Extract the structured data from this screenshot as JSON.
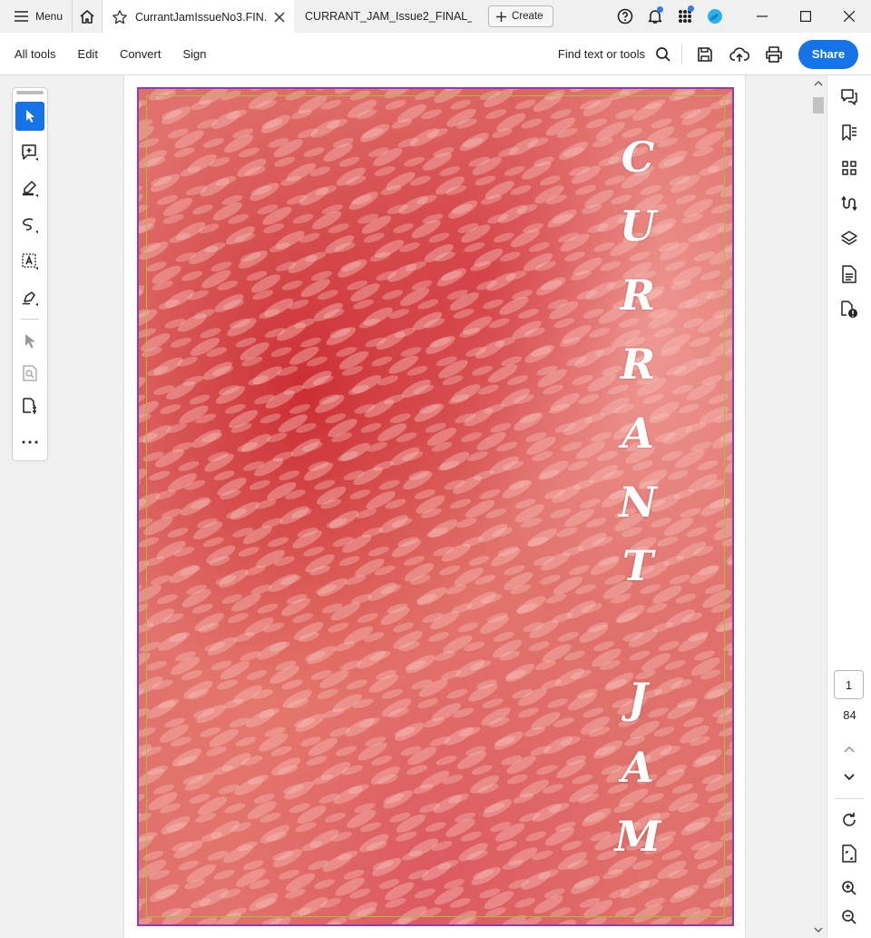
{
  "titlebar": {
    "menu_label": "Menu",
    "tabs": [
      {
        "label": "CurrantJamIssueNo3.FIN...",
        "active": true
      },
      {
        "label": "CURRANT_JAM_Issue2_FINAL_...",
        "active": false
      }
    ],
    "create_label": "Create"
  },
  "toolbar": {
    "menus": [
      "All tools",
      "Edit",
      "Convert",
      "Sign"
    ],
    "find_label": "Find text or tools",
    "share_label": "Share"
  },
  "document": {
    "cover_title_letters": [
      "C",
      "U",
      "R",
      "R",
      "A",
      "N",
      "T",
      "J",
      "A",
      "M"
    ]
  },
  "navigation": {
    "current_page": "1",
    "total_pages": "84"
  },
  "colors": {
    "accent": "#1473e6",
    "page_border": "#8a3fb2",
    "bleed_guide": "#9fc23a",
    "cover_base": "#e06a67"
  },
  "icons": {
    "left_rail": [
      "select-arrow-icon",
      "add-comment-icon",
      "highlight-icon",
      "draw-freeform-icon",
      "text-select-icon",
      "signature-icon",
      "pointer-icon",
      "zoom-marquee-icon",
      "edit-pdf-icon",
      "more-tools-icon"
    ],
    "right_rail": [
      "comments-icon",
      "bookmarks-icon",
      "thumbnails-icon",
      "compare-icon",
      "layers-icon",
      "document-properties-icon",
      "accessibility-icon",
      "rotate-icon",
      "fit-page-icon",
      "zoom-in-icon",
      "zoom-out-icon"
    ]
  }
}
